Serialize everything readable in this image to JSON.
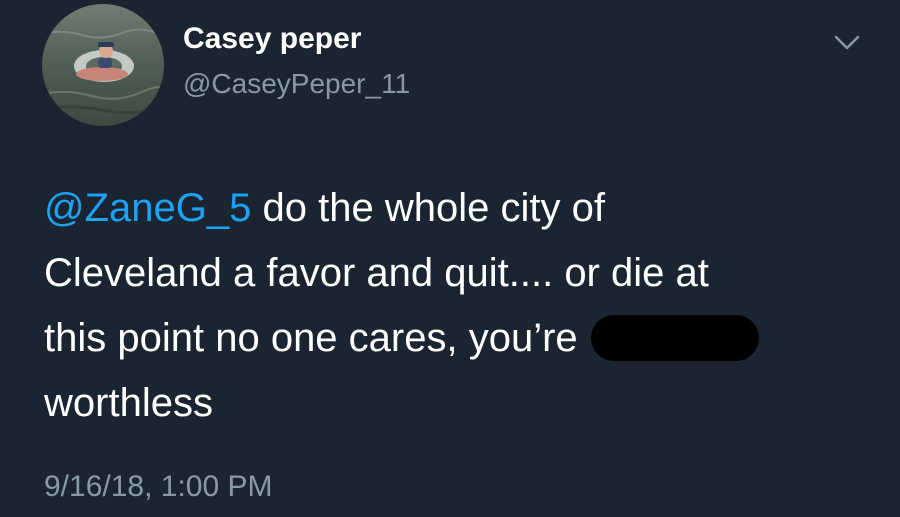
{
  "tweet": {
    "author": {
      "display_name": "Casey peper",
      "handle": "@CaseyPeper_11",
      "avatar_icon": "profile-photo"
    },
    "more_icon": "chevron-down-icon",
    "text": {
      "mention": "@ZaneG_5",
      "line1_rest": " do the whole city of",
      "line2": "Cleveland a favor and quit.... or die at",
      "line3": "this point no one cares, you’re ",
      "line4": "worthless"
    },
    "timestamp": "9/16/18, 1:00 PM"
  },
  "colors": {
    "background": "#1b2531",
    "text": "#ffffff",
    "secondary": "#8899a6",
    "link": "#1da1f2",
    "redaction": "#000000"
  }
}
